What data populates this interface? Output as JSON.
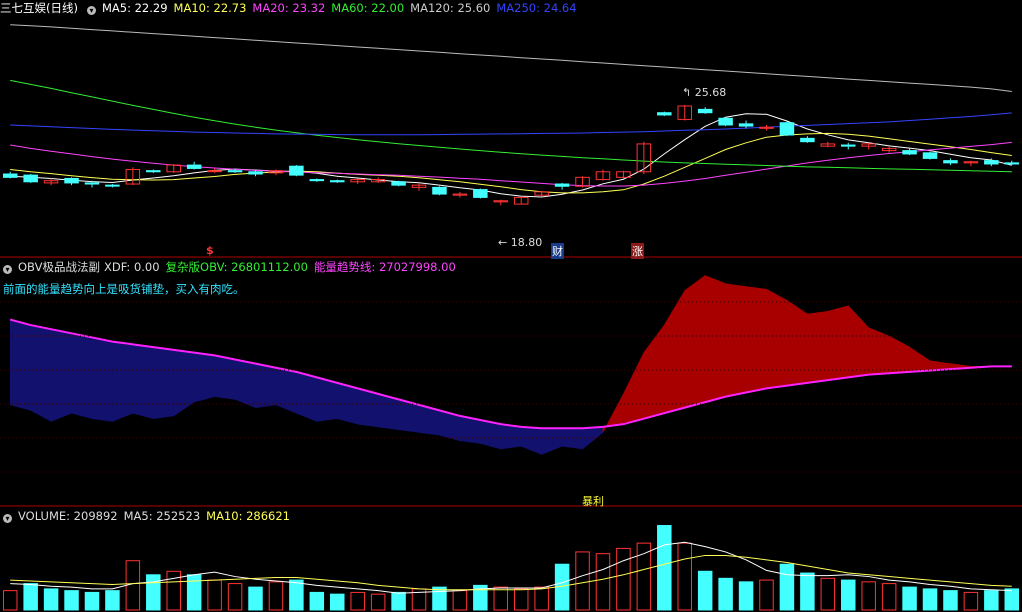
{
  "price_panel": {
    "title": "三七互娱(日线)",
    "ma_labels": [
      {
        "text": "MA5: 22.29",
        "color": "#ffffff"
      },
      {
        "text": "MA10: 22.73",
        "color": "#ffff55"
      },
      {
        "text": "MA20: 23.32",
        "color": "#ff44ff"
      },
      {
        "text": "MA60: 22.00",
        "color": "#33ee33"
      },
      {
        "text": "MA120: 25.60",
        "color": "#cccccc"
      },
      {
        "text": "MA250: 24.64",
        "color": "#3344ff"
      }
    ],
    "high_label": "25.68",
    "low_label": "18.80",
    "marker_dollar": "$",
    "marker_cai": "财",
    "marker_zhang": "涨"
  },
  "obv_panel": {
    "name": "OBV极品战法副",
    "xdf": "XDF: 0.00",
    "obv": "复杂版OBV: 26801112.00",
    "trend": "能量趋势线: 27027998.00",
    "note": "前面的能量趋势向上是吸货铺垫，买入有肉吃。",
    "bottom_label": "暴利"
  },
  "volume_panel": {
    "name": "VOLUME: 209892",
    "ma5": "MA5: 252523",
    "ma10": "MA10: 286621"
  },
  "colors": {
    "up": "#ff3333",
    "down": "#44ffff",
    "obv_fill_up": "#a80000",
    "obv_fill_down": "#12126e",
    "trend": "#ff22ff",
    "divider": "#b00000"
  },
  "chart_data": {
    "type": "candlestick",
    "candles": [
      [
        21.9,
        22.0,
        21.7,
        21.75,
        "d"
      ],
      [
        21.85,
        21.9,
        21.5,
        21.55,
        "d"
      ],
      [
        21.5,
        21.7,
        21.4,
        21.6,
        "u"
      ],
      [
        21.7,
        21.75,
        21.4,
        21.5,
        "d"
      ],
      [
        21.5,
        21.6,
        21.3,
        21.45,
        "d"
      ],
      [
        21.4,
        21.45,
        21.3,
        21.4,
        "d"
      ],
      [
        21.45,
        22.2,
        21.4,
        22.1,
        "u"
      ],
      [
        22.05,
        22.1,
        21.95,
        22.0,
        "d"
      ],
      [
        22.0,
        22.35,
        21.95,
        22.3,
        "u"
      ],
      [
        22.3,
        22.45,
        22.1,
        22.15,
        "d"
      ],
      [
        22.05,
        22.15,
        21.95,
        22.05,
        "u"
      ],
      [
        22.05,
        22.15,
        21.95,
        22.0,
        "d"
      ],
      [
        22.0,
        22.1,
        21.8,
        21.9,
        "d"
      ],
      [
        21.95,
        22.1,
        21.85,
        22.05,
        "u"
      ],
      [
        22.25,
        22.3,
        21.8,
        21.85,
        "d"
      ],
      [
        21.65,
        21.7,
        21.55,
        21.6,
        "d"
      ],
      [
        21.6,
        21.65,
        21.5,
        21.55,
        "d"
      ],
      [
        21.55,
        21.7,
        21.45,
        21.65,
        "u"
      ],
      [
        21.65,
        21.75,
        21.5,
        21.55,
        "u"
      ],
      [
        21.55,
        21.6,
        21.35,
        21.4,
        "d"
      ],
      [
        21.3,
        21.5,
        21.15,
        21.4,
        "u"
      ],
      [
        21.3,
        21.35,
        20.95,
        21.0,
        "d"
      ],
      [
        21.0,
        21.1,
        20.85,
        20.95,
        "u"
      ],
      [
        21.2,
        21.25,
        20.8,
        20.85,
        "d"
      ],
      [
        20.65,
        20.75,
        20.5,
        20.7,
        "u"
      ],
      [
        20.55,
        20.9,
        20.55,
        20.85,
        "u"
      ],
      [
        20.95,
        21.15,
        20.9,
        21.1,
        "u"
      ],
      [
        21.35,
        21.5,
        21.2,
        21.45,
        "d"
      ],
      [
        21.35,
        21.8,
        21.3,
        21.75,
        "u"
      ],
      [
        21.65,
        22.1,
        21.6,
        22.0,
        "u"
      ],
      [
        21.75,
        22.05,
        21.7,
        22.0,
        "u"
      ],
      [
        22.0,
        23.35,
        21.9,
        23.25,
        "u"
      ],
      [
        24.65,
        24.7,
        24.5,
        24.55,
        "d"
      ],
      [
        24.35,
        25.0,
        24.3,
        24.95,
        "u"
      ],
      [
        24.8,
        24.9,
        24.6,
        24.65,
        "d"
      ],
      [
        24.4,
        24.45,
        24.05,
        24.1,
        "d"
      ],
      [
        24.15,
        24.3,
        23.95,
        24.05,
        "d"
      ],
      [
        23.95,
        24.1,
        23.85,
        24.0,
        "u"
      ],
      [
        24.2,
        24.25,
        23.6,
        23.65,
        "d"
      ],
      [
        23.5,
        23.6,
        23.3,
        23.35,
        "d"
      ],
      [
        23.25,
        23.35,
        23.1,
        23.15,
        "u"
      ],
      [
        23.2,
        23.3,
        23.0,
        23.15,
        "d"
      ],
      [
        23.15,
        23.3,
        23.0,
        23.25,
        "u"
      ],
      [
        23.05,
        23.15,
        22.85,
        22.95,
        "u"
      ],
      [
        22.95,
        23.05,
        22.75,
        22.8,
        "d"
      ],
      [
        22.85,
        22.9,
        22.55,
        22.6,
        "d"
      ],
      [
        22.5,
        22.6,
        22.3,
        22.4,
        "d"
      ],
      [
        22.45,
        22.5,
        22.25,
        22.4,
        "u"
      ],
      [
        22.5,
        22.6,
        22.25,
        22.35,
        "d"
      ],
      [
        22.4,
        22.5,
        22.3,
        22.35,
        "d"
      ]
    ],
    "ma_series": [
      {
        "name": "MA5",
        "values": [
          21.8,
          21.75,
          21.7,
          21.62,
          21.56,
          21.52,
          21.63,
          21.72,
          21.82,
          21.95,
          22.06,
          22.12,
          22.08,
          22.03,
          22.02,
          21.93,
          21.8,
          21.72,
          21.63,
          21.56,
          21.51,
          21.4,
          21.28,
          21.18,
          21.01,
          20.91,
          20.87,
          20.99,
          21.18,
          21.46,
          21.66,
          22.12,
          22.8,
          23.44,
          24.04,
          24.45,
          24.6,
          24.58,
          24.28,
          23.92,
          23.66,
          23.43,
          23.3,
          23.16,
          23.06,
          22.95,
          22.79,
          22.63,
          22.53,
          22.29
        ]
      },
      {
        "name": "MA10",
        "values": [
          22.1,
          22.0,
          21.92,
          21.82,
          21.74,
          21.66,
          21.64,
          21.63,
          21.65,
          21.72,
          21.79,
          21.88,
          21.94,
          21.99,
          22.03,
          22.0,
          21.94,
          21.88,
          21.84,
          21.8,
          21.73,
          21.64,
          21.55,
          21.44,
          21.33,
          21.2,
          21.1,
          21.05,
          21.05,
          21.1,
          21.19,
          21.45,
          21.8,
          22.2,
          22.6,
          23.0,
          23.3,
          23.55,
          23.65,
          23.7,
          23.72,
          23.68,
          23.6,
          23.48,
          23.36,
          23.24,
          23.12,
          23.0,
          22.86,
          22.73
        ]
      },
      {
        "name": "MA20",
        "values": [
          23.2,
          23.05,
          22.92,
          22.8,
          22.68,
          22.57,
          22.47,
          22.38,
          22.3,
          22.23,
          22.17,
          22.11,
          22.06,
          22.02,
          21.99,
          21.96,
          21.93,
          21.9,
          21.87,
          21.84,
          21.8,
          21.76,
          21.71,
          21.66,
          21.6,
          21.54,
          21.48,
          21.42,
          21.38,
          21.36,
          21.36,
          21.4,
          21.48,
          21.58,
          21.7,
          21.84,
          21.98,
          22.12,
          22.26,
          22.4,
          22.52,
          22.63,
          22.73,
          22.82,
          22.9,
          22.98,
          23.06,
          23.14,
          23.22,
          23.32
        ]
      },
      {
        "name": "MA60",
        "values": [
          26.1,
          25.92,
          25.74,
          25.55,
          25.36,
          25.17,
          24.98,
          24.8,
          24.62,
          24.45,
          24.29,
          24.14,
          24.0,
          23.87,
          23.75,
          23.64,
          23.54,
          23.44,
          23.35,
          23.26,
          23.18,
          23.1,
          23.02,
          22.95,
          22.88,
          22.81,
          22.75,
          22.69,
          22.63,
          22.58,
          22.53,
          22.48,
          22.44,
          22.4,
          22.37,
          22.34,
          22.31,
          22.28,
          22.25,
          22.22,
          22.2,
          22.18,
          22.15,
          22.13,
          22.11,
          22.09,
          22.07,
          22.05,
          22.02,
          22.0
        ]
      },
      {
        "name": "MA120",
        "values": [
          28.6,
          28.55,
          28.5,
          28.44,
          28.38,
          28.32,
          28.26,
          28.2,
          28.14,
          28.08,
          28.02,
          27.96,
          27.9,
          27.84,
          27.78,
          27.72,
          27.66,
          27.6,
          27.54,
          27.48,
          27.42,
          27.36,
          27.3,
          27.24,
          27.18,
          27.12,
          27.06,
          27.0,
          26.94,
          26.88,
          26.82,
          26.76,
          26.7,
          26.64,
          26.58,
          26.52,
          26.46,
          26.4,
          26.34,
          26.28,
          26.22,
          26.16,
          26.1,
          26.04,
          25.98,
          25.92,
          25.86,
          25.8,
          25.72,
          25.6
        ]
      },
      {
        "name": "MA250",
        "values": [
          24.1,
          24.06,
          24.02,
          23.98,
          23.94,
          23.9,
          23.87,
          23.84,
          23.81,
          23.78,
          23.76,
          23.74,
          23.72,
          23.7,
          23.69,
          23.68,
          23.67,
          23.66,
          23.66,
          23.66,
          23.66,
          23.67,
          23.68,
          23.69,
          23.7,
          23.71,
          23.72,
          23.73,
          23.74,
          23.76,
          23.78,
          23.8,
          23.83,
          23.86,
          23.89,
          23.92,
          23.96,
          24.0,
          24.04,
          24.08,
          24.12,
          24.16,
          24.2,
          24.24,
          24.3,
          24.36,
          24.42,
          24.48,
          24.56,
          24.64
        ]
      }
    ],
    "price_range": [
      18.4,
      28.9
    ],
    "obv": [
      0.72,
      0.68,
      0.6,
      0.66,
      0.62,
      0.6,
      0.66,
      0.62,
      0.64,
      0.74,
      0.78,
      0.76,
      0.7,
      0.72,
      0.66,
      0.6,
      0.62,
      0.58,
      0.56,
      0.54,
      0.52,
      0.5,
      0.46,
      0.44,
      0.4,
      0.42,
      0.36,
      0.42,
      0.4,
      0.52,
      0.8,
      1.1,
      1.3,
      1.55,
      1.66,
      1.6,
      1.58,
      1.56,
      1.48,
      1.38,
      1.4,
      1.44,
      1.28,
      1.22,
      1.14,
      1.04,
      1.02,
      1.0,
      1.0,
      1.0
    ],
    "obv_trend": [
      1.34,
      1.3,
      1.27,
      1.24,
      1.21,
      1.18,
      1.16,
      1.14,
      1.12,
      1.1,
      1.08,
      1.05,
      1.02,
      0.99,
      0.96,
      0.92,
      0.88,
      0.84,
      0.8,
      0.76,
      0.72,
      0.68,
      0.64,
      0.61,
      0.58,
      0.56,
      0.55,
      0.55,
      0.55,
      0.56,
      0.58,
      0.62,
      0.66,
      0.7,
      0.74,
      0.78,
      0.81,
      0.84,
      0.86,
      0.88,
      0.9,
      0.92,
      0.94,
      0.95,
      0.96,
      0.97,
      0.98,
      0.99,
      1.0,
      1.0
    ],
    "volume": [
      [
        0.22,
        "u"
      ],
      [
        0.3,
        "d"
      ],
      [
        0.24,
        "d"
      ],
      [
        0.22,
        "d"
      ],
      [
        0.2,
        "d"
      ],
      [
        0.22,
        "d"
      ],
      [
        0.56,
        "u"
      ],
      [
        0.4,
        "d"
      ],
      [
        0.44,
        "u"
      ],
      [
        0.4,
        "d"
      ],
      [
        0.34,
        "u"
      ],
      [
        0.3,
        "u"
      ],
      [
        0.26,
        "d"
      ],
      [
        0.32,
        "u"
      ],
      [
        0.34,
        "d"
      ],
      [
        0.2,
        "d"
      ],
      [
        0.18,
        "d"
      ],
      [
        0.2,
        "u"
      ],
      [
        0.18,
        "u"
      ],
      [
        0.2,
        "d"
      ],
      [
        0.24,
        "u"
      ],
      [
        0.26,
        "d"
      ],
      [
        0.22,
        "u"
      ],
      [
        0.28,
        "d"
      ],
      [
        0.26,
        "u"
      ],
      [
        0.24,
        "u"
      ],
      [
        0.26,
        "u"
      ],
      [
        0.52,
        "d"
      ],
      [
        0.66,
        "u"
      ],
      [
        0.64,
        "u"
      ],
      [
        0.7,
        "u"
      ],
      [
        0.76,
        "u"
      ],
      [
        0.96,
        "d"
      ],
      [
        0.76,
        "u"
      ],
      [
        0.44,
        "d"
      ],
      [
        0.36,
        "d"
      ],
      [
        0.32,
        "d"
      ],
      [
        0.34,
        "u"
      ],
      [
        0.52,
        "d"
      ],
      [
        0.42,
        "d"
      ],
      [
        0.36,
        "u"
      ],
      [
        0.34,
        "d"
      ],
      [
        0.32,
        "u"
      ],
      [
        0.3,
        "u"
      ],
      [
        0.26,
        "d"
      ],
      [
        0.24,
        "d"
      ],
      [
        0.22,
        "d"
      ],
      [
        0.2,
        "u"
      ],
      [
        0.22,
        "d"
      ],
      [
        0.24,
        "d"
      ]
    ],
    "volume_ma": [
      {
        "name": "MA5",
        "values": [
          0.3,
          0.29,
          0.27,
          0.26,
          0.24,
          0.24,
          0.3,
          0.32,
          0.36,
          0.4,
          0.43,
          0.38,
          0.35,
          0.33,
          0.31,
          0.28,
          0.26,
          0.24,
          0.22,
          0.19,
          0.2,
          0.21,
          0.22,
          0.24,
          0.25,
          0.25,
          0.25,
          0.31,
          0.39,
          0.46,
          0.56,
          0.64,
          0.74,
          0.77,
          0.72,
          0.66,
          0.57,
          0.45,
          0.4,
          0.39,
          0.39,
          0.4,
          0.38,
          0.34,
          0.32,
          0.29,
          0.27,
          0.24,
          0.23,
          0.22
        ]
      },
      {
        "name": "MA10",
        "values": [
          0.34,
          0.33,
          0.32,
          0.31,
          0.3,
          0.29,
          0.3,
          0.31,
          0.32,
          0.33,
          0.34,
          0.35,
          0.36,
          0.37,
          0.37,
          0.35,
          0.33,
          0.31,
          0.28,
          0.26,
          0.24,
          0.23,
          0.23,
          0.23,
          0.23,
          0.23,
          0.24,
          0.27,
          0.31,
          0.35,
          0.4,
          0.46,
          0.52,
          0.58,
          0.62,
          0.62,
          0.6,
          0.57,
          0.54,
          0.5,
          0.46,
          0.42,
          0.4,
          0.38,
          0.36,
          0.34,
          0.32,
          0.3,
          0.28,
          0.27
        ]
      }
    ]
  }
}
